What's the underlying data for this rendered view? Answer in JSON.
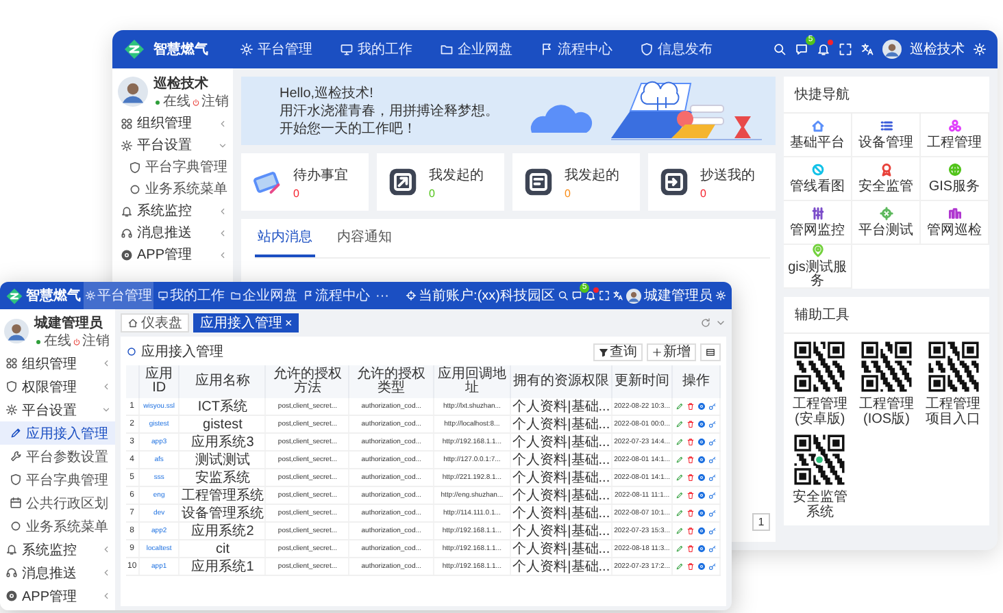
{
  "back_window": {
    "header": {
      "logo_text": "智慧燃气",
      "menu": [
        {
          "label": "平台管理",
          "selected": false
        },
        {
          "label": "我的工作",
          "selected": false
        },
        {
          "label": "企业网盘",
          "selected": false
        },
        {
          "label": "流程中心",
          "selected": false
        },
        {
          "label": "信息发布",
          "selected": false
        }
      ],
      "badge": "5",
      "alert": true,
      "user": "巡检技术"
    },
    "sidebar": {
      "user": {
        "name": "巡检技术",
        "online": "在线",
        "logout": "注销"
      },
      "items": [
        {
          "label": "组织管理",
          "expanded": false
        },
        {
          "label": "平台设置",
          "expanded": true,
          "children": [
            {
              "label": "平台字典管理",
              "selected": false
            },
            {
              "label": "业务系统菜单",
              "selected": false
            }
          ]
        },
        {
          "label": "系统监控",
          "expanded": false
        },
        {
          "label": "消息推送",
          "expanded": false
        },
        {
          "label": "APP管理",
          "expanded": false
        }
      ]
    },
    "banner": {
      "greeting": "Hello,巡检技术!",
      "lines": [
        "用汗水浇灌青春，用拼搏诠释梦想。",
        "开始您一天的工作吧！"
      ]
    },
    "stats": [
      {
        "label": "待办事宜",
        "value": "0",
        "color": "#f5222d"
      },
      {
        "label": "我发起的",
        "value": "0",
        "color": "#52c41a"
      },
      {
        "label": "我发起的",
        "value": "0",
        "color": "#fa8c16"
      },
      {
        "label": "抄送我的",
        "value": "0",
        "color": "#f5222d"
      }
    ],
    "messages": {
      "tabs": [
        {
          "label": "站内消息",
          "selected": true
        },
        {
          "label": "内容通知",
          "selected": false
        }
      ],
      "page": "1"
    },
    "quick_nav": {
      "title": "快捷导航",
      "items": [
        {
          "label": "基础平台",
          "color": "#5b8ff9"
        },
        {
          "label": "设备管理",
          "color": "#3a5bd9"
        },
        {
          "label": "工程管理",
          "color": "#e040fb"
        },
        {
          "label": "管线看图",
          "color": "#13c2e8"
        },
        {
          "label": "安全监管",
          "color": "#e8413a"
        },
        {
          "label": "GIS服务",
          "color": "#52c41a"
        },
        {
          "label": "管网监控",
          "color": "#7b4cc9"
        },
        {
          "label": "平台测试",
          "color": "#5cb85c"
        },
        {
          "label": "管网巡检",
          "color": "#b037d0"
        },
        {
          "label": "gis测试服务",
          "color": "#73d13d"
        }
      ]
    },
    "tools": {
      "title": "辅助工具",
      "items": [
        {
          "kind": "qr",
          "label": "工程管理(安卓版)"
        },
        {
          "kind": "qr",
          "label": "工程管理(IOS版)"
        },
        {
          "kind": "qr",
          "label": "工程管理项目入口"
        },
        {
          "kind": "miniprogram",
          "label": "安全监管系统"
        }
      ]
    }
  },
  "front_window": {
    "header": {
      "logo_text": "智慧燃气",
      "menu": [
        {
          "label": "平台管理",
          "selected": true
        },
        {
          "label": "我的工作",
          "selected": false
        },
        {
          "label": "企业网盘",
          "selected": false
        },
        {
          "label": "流程中心",
          "selected": false
        }
      ],
      "more": "···",
      "tenant": "当前账户:(xx)科技园区",
      "badge": "5",
      "alert": true,
      "user": "城建管理员"
    },
    "sidebar": {
      "user": {
        "name": "城建管理员",
        "online": "在线",
        "logout": "注销"
      },
      "items": [
        {
          "label": "组织管理",
          "expanded": false
        },
        {
          "label": "权限管理",
          "expanded": false
        },
        {
          "label": "平台设置",
          "expanded": true,
          "children": [
            {
              "label": "应用接入管理",
              "selected": true
            },
            {
              "label": "平台参数设置",
              "selected": false
            },
            {
              "label": "平台字典管理",
              "selected": false
            },
            {
              "label": "公共行政区划",
              "selected": false
            },
            {
              "label": "业务系统菜单",
              "selected": false
            }
          ]
        },
        {
          "label": "系统监控",
          "expanded": false
        },
        {
          "label": "消息推送",
          "expanded": false
        },
        {
          "label": "APP管理",
          "expanded": false
        }
      ]
    },
    "tabs": [
      {
        "label": "仪表盘",
        "selected": false
      },
      {
        "label": "应用接入管理",
        "selected": true,
        "close": "×"
      }
    ],
    "panel": {
      "title": "应用接入管理",
      "buttons": [
        {
          "kind": "filter",
          "label": "查询"
        },
        {
          "kind": "add",
          "label": "新增"
        },
        {
          "kind": "columns"
        }
      ]
    },
    "table": {
      "columns": [
        "",
        "应用ID",
        "应用名称",
        "允许的授权方法",
        "允许的授权类型",
        "应用回调地址",
        "拥有的资源权限",
        "更新时间",
        "操作"
      ],
      "rows": [
        [
          "1",
          "wisyou.ssl",
          "ICT系统",
          "post,client_secret...",
          "authorization_cod...",
          "http://lxt.shuzhan...",
          "个人资料|基础...",
          "2022-08-22 10:3..."
        ],
        [
          "2",
          "gistest",
          "gistest",
          "post,client_secret...",
          "authorization_cod...",
          "http://localhost:8...",
          "个人资料|基础...",
          "2022-08-01 00:0..."
        ],
        [
          "3",
          "app3",
          "应用系统3",
          "post,client_secret...",
          "authorization_cod...",
          "http://192.168.1.1...",
          "个人资料|基础...",
          "2022-07-23 14:4..."
        ],
        [
          "4",
          "afs",
          "测试测试",
          "post,client_secret...",
          "authorization_cod...",
          "http://127.0.0.1:7...",
          "个人资料|基础...",
          "2022-08-01 14:1..."
        ],
        [
          "5",
          "sss",
          "安监系统",
          "post,client_secret...",
          "authorization_cod...",
          "http://221.192.8.1...",
          "个人资料|基础...",
          "2022-08-01 14:1..."
        ],
        [
          "6",
          "eng",
          "工程管理系统",
          "post,client_secret...",
          "authorization_cod...",
          "http://eng.shuzhan...",
          "个人资料|基础...",
          "2022-08-11 11:1..."
        ],
        [
          "7",
          "dev",
          "设备管理系统",
          "post,client_secret...",
          "authorization_cod...",
          "http://114.111.0.1...",
          "个人资料|基础...",
          "2022-08-07 10:1..."
        ],
        [
          "8",
          "app2",
          "应用系统2",
          "post,client_secret...",
          "authorization_cod...",
          "http://192.168.1.1...",
          "个人资料|基础...",
          "2022-07-23 15:3..."
        ],
        [
          "9",
          "localtest",
          "cit",
          "post,client_secret...",
          "authorization_cod...",
          "http://192.168.1.1...",
          "个人资料|基础...",
          "2022-08-18 11:3..."
        ],
        [
          "10",
          "app1",
          "应用系统1",
          "post,client_secret...",
          "authorization_cod...",
          "http://192.168.1.1...",
          "个人资料|基础...",
          "2022-07-23 17:2..."
        ]
      ]
    }
  }
}
